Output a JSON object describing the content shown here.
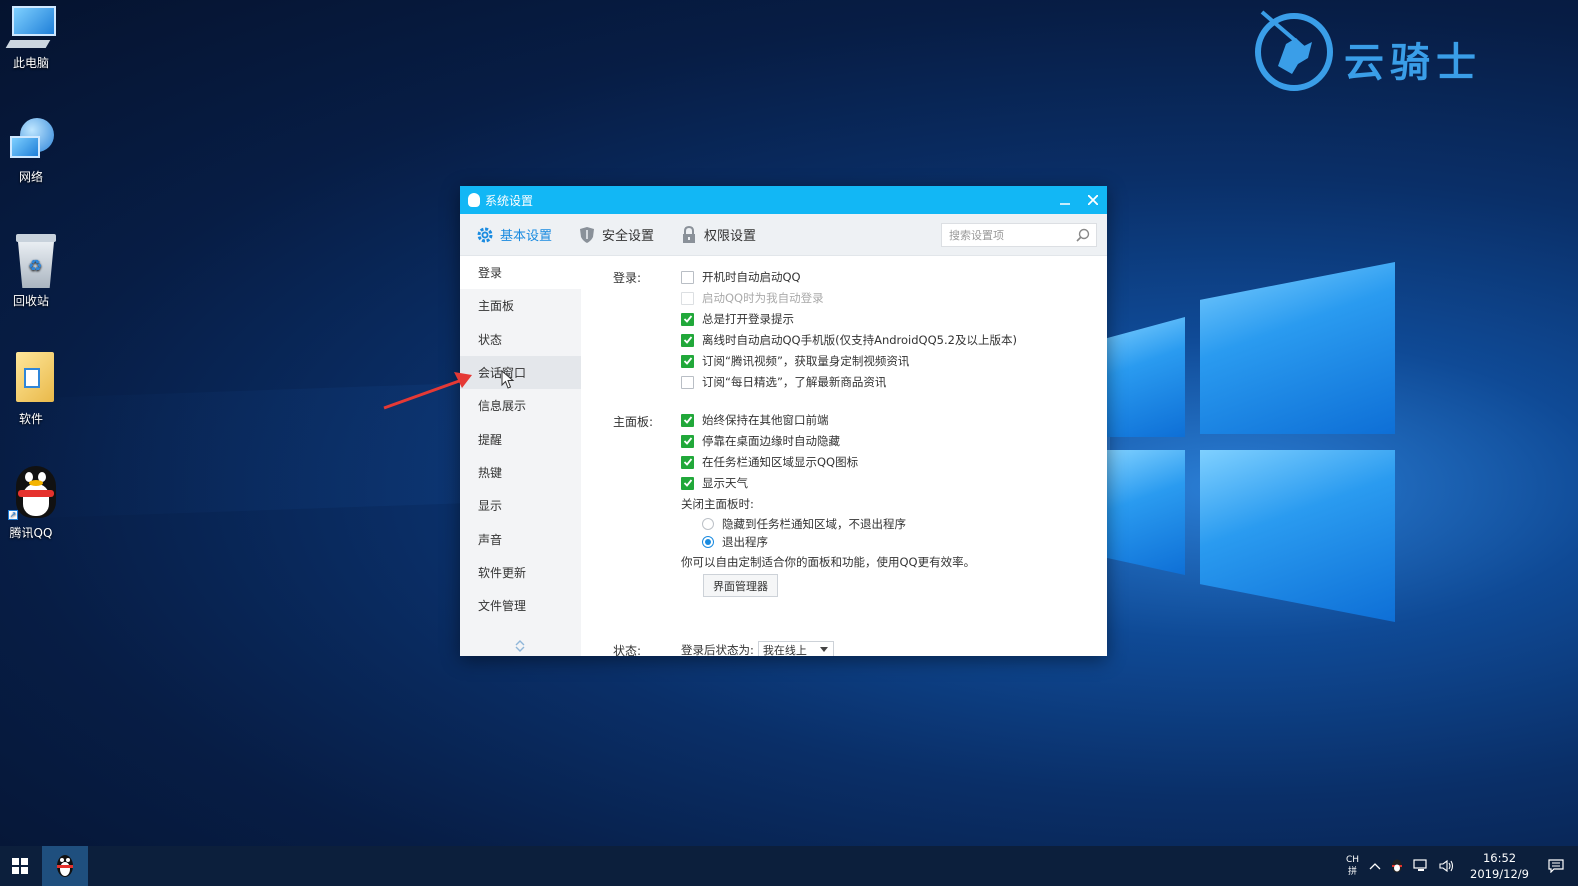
{
  "desktop": {
    "icons": [
      {
        "label": "此电脑",
        "icon": "computer-icon"
      },
      {
        "label": "网络",
        "icon": "network-icon"
      },
      {
        "label": "回收站",
        "icon": "recycle-bin-icon"
      },
      {
        "label": "软件",
        "icon": "folder-icon"
      },
      {
        "label": "腾讯QQ",
        "icon": "qq-penguin-icon"
      }
    ],
    "brand": "云骑士"
  },
  "dialog": {
    "title": "系统设置",
    "tabs": [
      {
        "label": "基本设置",
        "icon": "gear-icon",
        "active": true
      },
      {
        "label": "安全设置",
        "icon": "shield-icon",
        "active": false
      },
      {
        "label": "权限设置",
        "icon": "lock-icon",
        "active": false
      }
    ],
    "search_placeholder": "搜索设置项",
    "sidebar": [
      "登录",
      "主面板",
      "状态",
      "会话窗口",
      "信息展示",
      "提醒",
      "热键",
      "显示",
      "声音",
      "软件更新",
      "文件管理"
    ],
    "login": {
      "label": "登录:",
      "options": [
        {
          "text": "开机时自动启动QQ",
          "checked": false,
          "disabled": false
        },
        {
          "text": "启动QQ时为我自动登录",
          "checked": false,
          "disabled": true
        },
        {
          "text": "总是打开登录提示",
          "checked": true,
          "disabled": false
        },
        {
          "text": "离线时自动启动QQ手机版(仅支持AndroidQQ5.2及以上版本)",
          "checked": true,
          "disabled": false
        },
        {
          "text": "订阅“腾讯视频”，获取量身定制视频资讯",
          "checked": true,
          "disabled": false
        },
        {
          "text": "订阅“每日精选”，了解最新商品资讯",
          "checked": false,
          "disabled": false
        }
      ]
    },
    "panel": {
      "label": "主面板:",
      "options": [
        {
          "text": "始终保持在其他窗口前端",
          "checked": true
        },
        {
          "text": "停靠在桌面边缘时自动隐藏",
          "checked": true
        },
        {
          "text": "在任务栏通知区域显示QQ图标",
          "checked": true
        },
        {
          "text": "显示天气",
          "checked": true
        }
      ],
      "close_label": "关闭主面板时:",
      "radios": [
        {
          "text": "隐藏到任务栏通知区域，不退出程序",
          "selected": false
        },
        {
          "text": "退出程序",
          "selected": true
        }
      ],
      "hint": "你可以自由定制适合你的面板和功能，使用QQ更有效率。",
      "manager_button": "界面管理器"
    },
    "status": {
      "label": "状态:",
      "after_login_label": "登录后状态为:",
      "value": "我在线上"
    }
  },
  "taskbar": {
    "ime_top": "CH",
    "ime_bottom": "拼",
    "time": "16:52",
    "date": "2019/12/9"
  },
  "colors": {
    "titlebar": "#12b7f5",
    "active_tab": "#1a8be0",
    "checkbox_on": "#21a83a",
    "annotation_arrow": "#e53935"
  }
}
